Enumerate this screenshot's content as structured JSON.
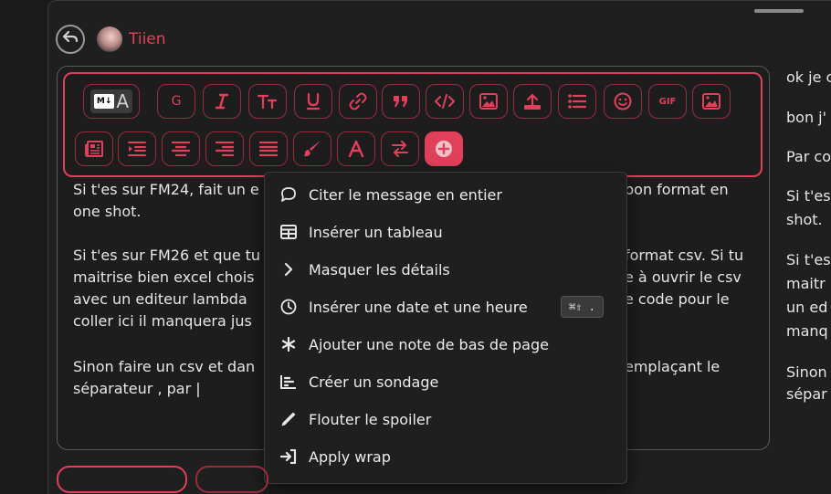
{
  "header": {
    "username": "Tiien"
  },
  "toolbar": {
    "row1": [
      "markdown-toggle",
      "gras",
      "italique",
      "titre",
      "souligne",
      "lien",
      "citation",
      "code",
      "image",
      "upload",
      "liste",
      "emoji",
      "gif",
      "image-2"
    ],
    "gif_label": "GIF",
    "gras_label": "G"
  },
  "editor": {
    "lines": [
      "Si t'es sur FM24, fait un e",
      "one shot.",
      "Si t'es sur FM26 et que tu",
      "maitrise bien excel chois",
      "avec un editeur lambda",
      "coller ici il manquera jus",
      "Sinon faire un csv et dan",
      "séparateur , par |"
    ],
    "right_fragments": [
      "bon format en",
      "format csv. Si tu",
      "e à ouvrir le csv",
      "e code pour le",
      "emplaçant le"
    ]
  },
  "menu": {
    "items": [
      {
        "label": "Citer le message en entier",
        "icon": "comment-icon"
      },
      {
        "label": "Insérer un tableau",
        "icon": "table-icon"
      },
      {
        "label": "Masquer les détails",
        "icon": "chevron-right-icon"
      },
      {
        "label": "Insérer une date et une heure",
        "icon": "clock-icon",
        "shortcut": "⌘⇧ ."
      },
      {
        "label": "Ajouter une note de bas de page",
        "icon": "asterisk-icon"
      },
      {
        "label": "Créer un sondage",
        "icon": "chart-icon"
      },
      {
        "label": "Flouter le spoiler",
        "icon": "pen-icon"
      },
      {
        "label": "Apply wrap",
        "icon": "sign-in-icon"
      }
    ]
  },
  "side_text": [
    "ok je c",
    "bon j'",
    "Par co",
    "Si t'es",
    "shot.",
    "Si t'es",
    "maitr",
    "un ed",
    "manq",
    "Sinon",
    "sépar"
  ],
  "colors": {
    "accent": "#e0405a",
    "background": "#1a1a1b"
  }
}
